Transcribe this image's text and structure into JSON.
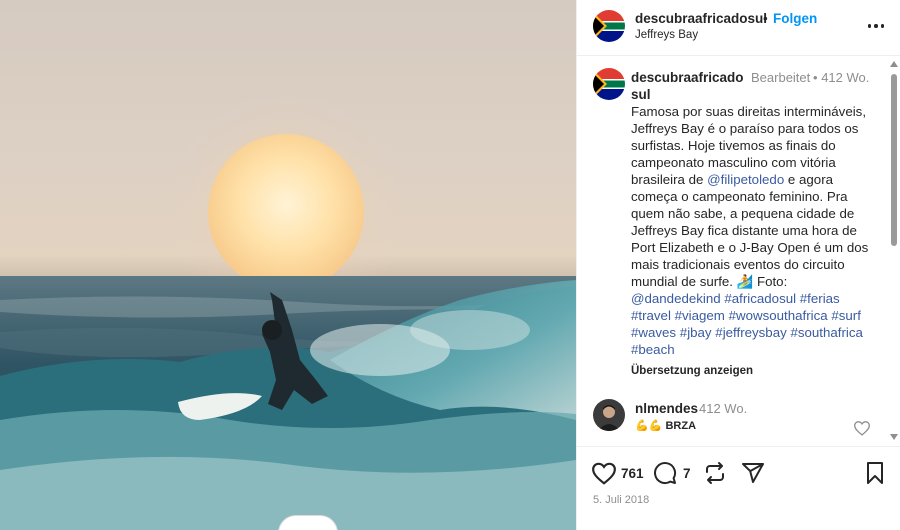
{
  "post": {
    "username": "descubraafricadosul",
    "separator": "•",
    "follow_label": "Folgen",
    "location": "Jeffreys Bay",
    "more_icon": "more-options-icon",
    "image_alt": "surfer-at-sunset-photo"
  },
  "caption": {
    "username": "descubraafricadosul",
    "edited_label": "Bearbeitet",
    "separator": "•",
    "time": "412 Wo.",
    "text_1": "Famosa por suas direitas intermináveis, Jeffreys Bay é o paraíso para todos os surfistas. Hoje tivemos as finais do campeonato masculino com vitória brasileira de ",
    "mention_1": "@filipetoledo",
    "text_2": " e agora começa o campeonato feminino. Pra quem não sabe, a pequena cidade de Jeffreys Bay fica distante uma hora de Port Elizabeth e o J-Bay Open é um dos mais tradicionais eventos do circuito mundial de surfe. ",
    "emoji": "🏄",
    "text_3": " Foto:",
    "mention_2": "@dandedekind",
    "hashtags": [
      "#africadosul",
      "#ferias",
      "#travel",
      "#viagem",
      "#wowsouthafrica",
      "#surf",
      "#waves",
      "#jbay",
      "#jeffreysbay",
      "#southafrica",
      "#beach"
    ],
    "translate_label": "Übersetzung anzeigen"
  },
  "comment": {
    "username": "nlmendes",
    "time": "412 Wo.",
    "emojis": "💪💪",
    "text": "BRZA"
  },
  "actions": {
    "likes": "761",
    "comments": "7",
    "date": "5. Juli 2018"
  },
  "colors": {
    "accent_blue": "#0095f6",
    "link_blue": "#3a5ba0",
    "text": "#262626",
    "secondary": "#8e8e8e"
  }
}
